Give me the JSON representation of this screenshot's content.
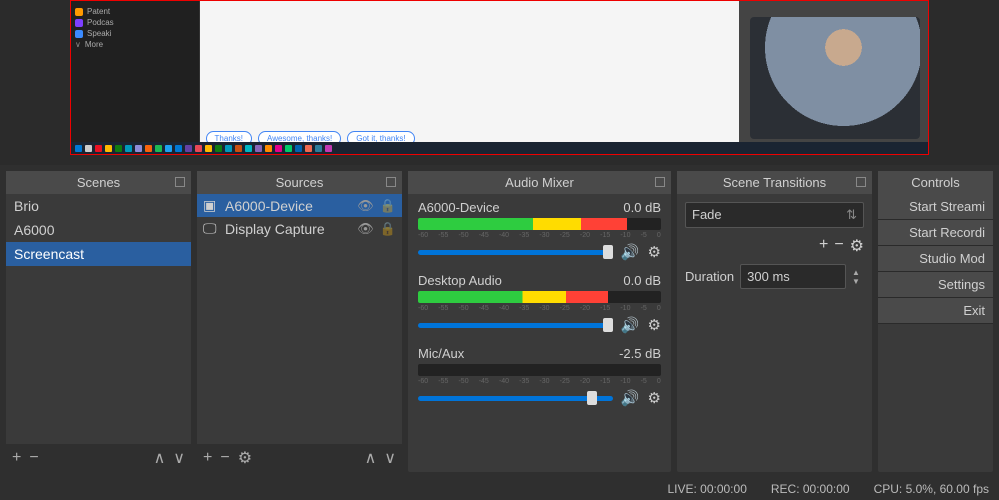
{
  "preview": {
    "sidebar_items": [
      {
        "color": "orange",
        "label": "Patent"
      },
      {
        "color": "purple",
        "label": "Podcas"
      },
      {
        "color": "blue",
        "label": "Speaki"
      }
    ],
    "more_label": "More",
    "reply_buttons": [
      "Thanks!",
      "Awesome, thanks!",
      "Got it, thanks!"
    ]
  },
  "panels": {
    "scenes": {
      "title": "Scenes",
      "items": [
        "Brio",
        "A6000",
        "Screencast"
      ],
      "selected": 2
    },
    "sources": {
      "title": "Sources",
      "items": [
        {
          "icon": "camera",
          "label": "A6000-Device",
          "selected": true
        },
        {
          "icon": "display",
          "label": "Display Capture",
          "selected": false
        }
      ]
    },
    "mixer": {
      "title": "Audio Mixer",
      "channels": [
        {
          "name": "A6000-Device",
          "db": "0.0 dB",
          "fill": 86,
          "slider": 100
        },
        {
          "name": "Desktop Audio",
          "db": "0.0 dB",
          "fill": 78,
          "slider": 100
        },
        {
          "name": "Mic/Aux",
          "db": "-2.5 dB",
          "fill": 0,
          "slider": 92
        }
      ],
      "ticks": [
        "-60",
        "-55",
        "-50",
        "-45",
        "-40",
        "-35",
        "-30",
        "-25",
        "-20",
        "-15",
        "-10",
        "-5",
        "0"
      ]
    },
    "transitions": {
      "title": "Scene Transitions",
      "type": "Fade",
      "duration_label": "Duration",
      "duration_value": "300 ms"
    },
    "controls": {
      "title": "Controls",
      "buttons": [
        "Start Streami",
        "Start Recordi",
        "Studio Mod",
        "Settings",
        "Exit"
      ]
    }
  },
  "status": {
    "live": "LIVE: 00:00:00",
    "rec": "REC: 00:00:00",
    "cpu": "CPU: 5.0%, 60.00 fps"
  },
  "taskbar_colors": [
    "#0078d4",
    "#ccc",
    "#e81123",
    "#ffb900",
    "#107c10",
    "#0099bc",
    "#8e8cd8",
    "#f7630c",
    "#1db954",
    "#1da1f2",
    "#0078d4",
    "#6441a5",
    "#e74856",
    "#ffb900",
    "#107c10",
    "#0099bc",
    "#ca5010",
    "#00b7c3",
    "#8764b8",
    "#ff8c00",
    "#e3008c",
    "#00cc6a",
    "#0063b1",
    "#ef6950",
    "#2d7d9a",
    "#c239b3"
  ]
}
